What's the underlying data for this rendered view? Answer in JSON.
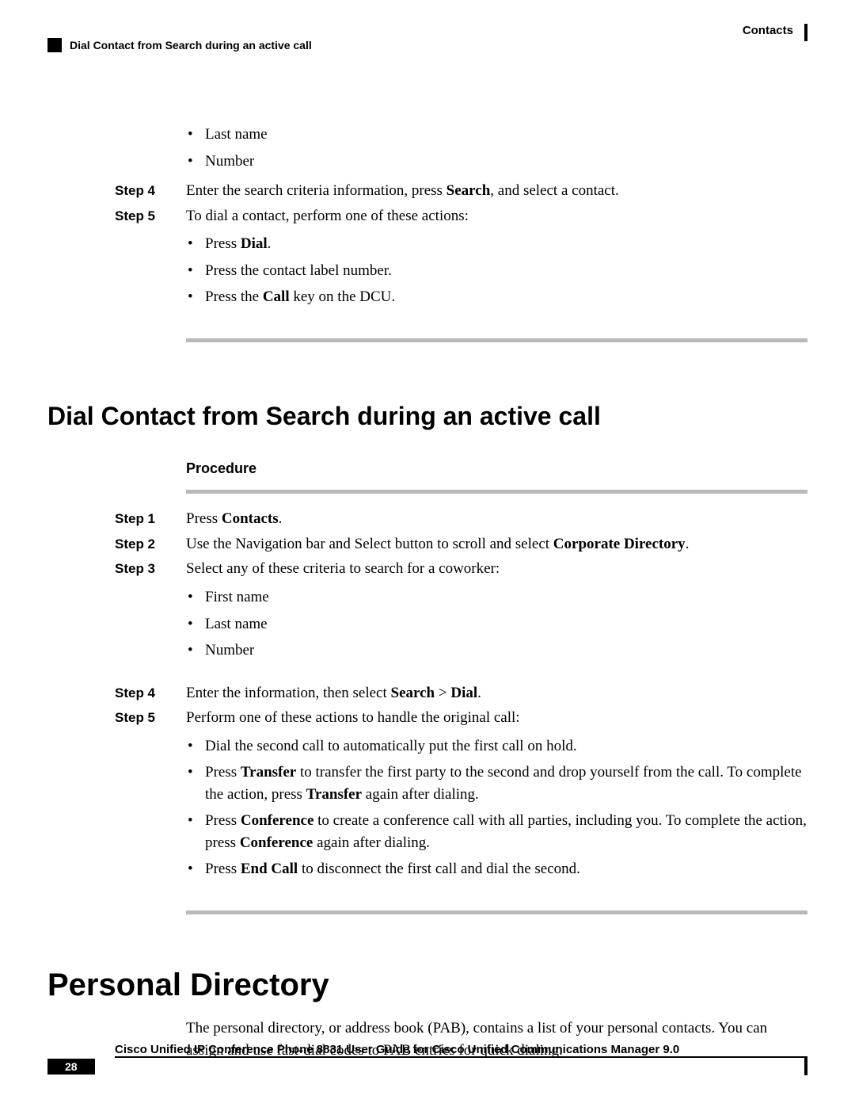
{
  "header": {
    "breadcrumb": "Contacts",
    "running_title": "Dial Contact from Search during an active call"
  },
  "top_block": {
    "bullets": [
      "Last name",
      "Number"
    ],
    "step4": {
      "label": "Step 4",
      "text_pre": "Enter the search criteria information, press ",
      "bold1": "Search",
      "text_post": ", and select a contact."
    },
    "step5": {
      "label": "Step 5",
      "text": "To dial a contact, perform one of these actions:"
    },
    "step5_bullets": {
      "b1_pre": "Press ",
      "b1_bold": "Dial",
      "b1_post": ".",
      "b2": "Press the contact label number.",
      "b3_pre": "Press the ",
      "b3_bold": "Call",
      "b3_post": " key on the DCU."
    }
  },
  "section2": {
    "heading": "Dial Contact from Search during an active call",
    "procedure_label": "Procedure",
    "step1": {
      "label": "Step 1",
      "pre": "Press ",
      "bold": "Contacts",
      "post": "."
    },
    "step2": {
      "label": "Step 2",
      "pre": "Use the Navigation bar and Select button to scroll and select ",
      "bold": "Corporate Directory",
      "post": "."
    },
    "step3": {
      "label": "Step 3",
      "text": "Select any of these criteria to search for a coworker:"
    },
    "step3_bullets": [
      "First name",
      "Last name",
      "Number"
    ],
    "step4": {
      "label": "Step 4",
      "pre": "Enter the information, then select ",
      "bold1": "Search",
      "mid": " > ",
      "bold2": "Dial",
      "post": "."
    },
    "step5": {
      "label": "Step 5",
      "text": "Perform one of these actions to handle the original call:"
    },
    "step5_bullets": {
      "b1": "Dial the second call to automatically put the first call on hold.",
      "b2_pre": "Press ",
      "b2_bold1": "Transfer",
      "b2_mid": " to transfer the first party to the second and drop yourself from the call. To complete the action, press ",
      "b2_bold2": "Transfer",
      "b2_post": " again after dialing.",
      "b3_pre": "Press ",
      "b3_bold1": "Conference",
      "b3_mid": " to create a conference call with all parties, including you. To complete the action, press ",
      "b3_bold2": "Conference",
      "b3_post": " again after dialing.",
      "b4_pre": "Press ",
      "b4_bold": "End Call",
      "b4_post": " to disconnect the first call and dial the second."
    }
  },
  "section3": {
    "heading": "Personal Directory",
    "body": "The personal directory, or address book (PAB), contains a list of your personal contacts. You can assign and use fast-dial codes to PAB entries for quick dialing."
  },
  "footer": {
    "doc_title": "Cisco Unified IP Conference Phone 8831 User Guide for Cisco Unified Communications Manager 9.0",
    "page_number": "28"
  }
}
